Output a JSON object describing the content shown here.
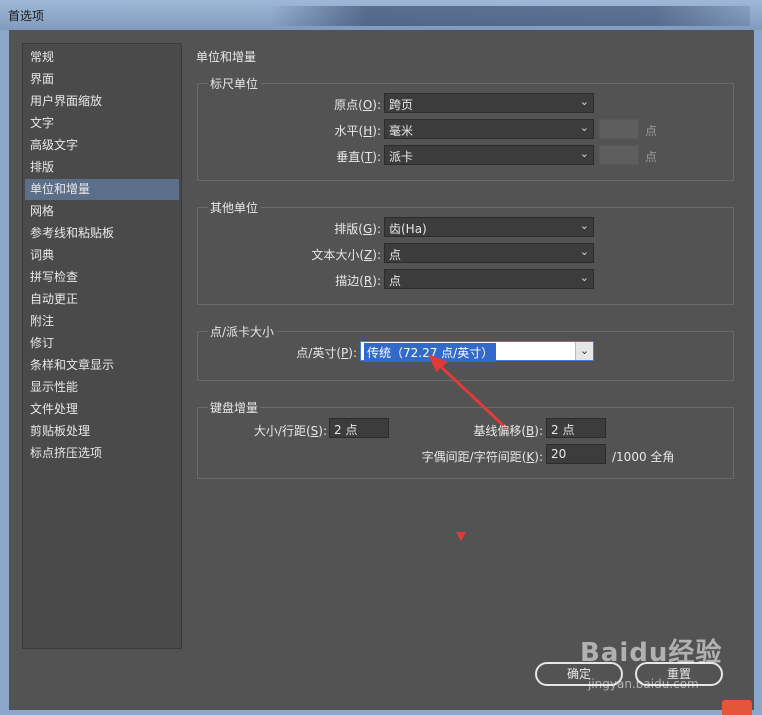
{
  "window": {
    "title": "首选项"
  },
  "sidebar": {
    "items": [
      {
        "label": "常规"
      },
      {
        "label": "界面"
      },
      {
        "label": "用户界面缩放"
      },
      {
        "label": "文字"
      },
      {
        "label": "高级文字"
      },
      {
        "label": "排版"
      },
      {
        "label": "单位和增量",
        "selected": true
      },
      {
        "label": "网格"
      },
      {
        "label": "参考线和粘贴板"
      },
      {
        "label": "词典"
      },
      {
        "label": "拼写检查"
      },
      {
        "label": "自动更正"
      },
      {
        "label": "附注"
      },
      {
        "label": "修订"
      },
      {
        "label": "条样和文章显示"
      },
      {
        "label": "显示性能"
      },
      {
        "label": "文件处理"
      },
      {
        "label": "剪贴板处理"
      },
      {
        "label": "标点挤压选项"
      }
    ]
  },
  "main": {
    "section_title": "单位和增量",
    "ruler_units": {
      "title": "标尺单位",
      "origin": {
        "label": "原点",
        "key": "O",
        "value": "跨页"
      },
      "horizontal": {
        "label": "水平",
        "key": "H",
        "value": "毫米",
        "unit": "点"
      },
      "vertical": {
        "label": "垂直",
        "key": "T",
        "value": "派卡",
        "unit": "点"
      }
    },
    "other_units": {
      "title": "其他单位",
      "composition": {
        "label": "排版",
        "key": "G",
        "value": "齿(Ha)"
      },
      "text_size": {
        "label": "文本大小",
        "key": "Z",
        "value": "点"
      },
      "stroke": {
        "label": "描边",
        "key": "R",
        "value": "点"
      }
    },
    "point_pica": {
      "title": "点/派卡大小",
      "points_inch": {
        "label": "点/英寸",
        "key": "P",
        "value": "传统（72.27 点/英寸）"
      }
    },
    "keyboard": {
      "title": "键盘增量",
      "size_leading": {
        "label": "大小/行距",
        "key": "S",
        "value": "2 点"
      },
      "baseline_shift": {
        "label": "基线偏移",
        "key": "B",
        "value": "2 点"
      },
      "kerning_tracking": {
        "label": "字偶间距/字符间距",
        "key": "K",
        "value": "20",
        "unit": "/1000 全角"
      }
    }
  },
  "buttons": {
    "ok": "确定",
    "reset": "重置"
  },
  "watermark": {
    "brand": "Baidu经验",
    "url": "jingyan.baidu.com"
  },
  "colors": {
    "panel": "#535353",
    "selection": "#5b6e8a",
    "highlight": "#3369c9",
    "annotation": "#e23a3a"
  }
}
